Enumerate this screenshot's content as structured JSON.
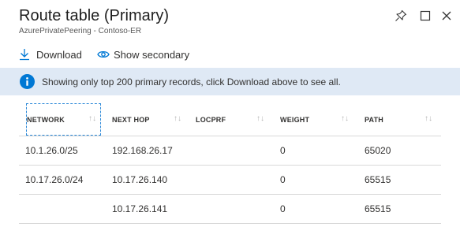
{
  "header": {
    "title": "Route table (Primary)",
    "subtitle": "AzurePrivatePeering - Contoso-ER"
  },
  "toolbar": {
    "download_label": "Download",
    "show_secondary_label": "Show secondary"
  },
  "banner": {
    "message": "Showing only top 200 primary records, click Download above to see all.",
    "icon": "info-icon"
  },
  "table": {
    "columns": [
      "NETWORK",
      "NEXT HOP",
      "LOCPRF",
      "WEIGHT",
      "PATH"
    ],
    "rows": [
      {
        "network": "10.1.26.0/25",
        "next_hop": "192.168.26.17",
        "locprf": "",
        "weight": "0",
        "path": "65020"
      },
      {
        "network": "10.17.26.0/24",
        "next_hop": "10.17.26.140",
        "locprf": "",
        "weight": "0",
        "path": "65515"
      },
      {
        "network": "",
        "next_hop": "10.17.26.141",
        "locprf": "",
        "weight": "0",
        "path": "65515"
      }
    ]
  },
  "colors": {
    "accent": "#0078d4",
    "banner_bg": "#dfe9f5",
    "focus_outline": "#2b88d8"
  }
}
